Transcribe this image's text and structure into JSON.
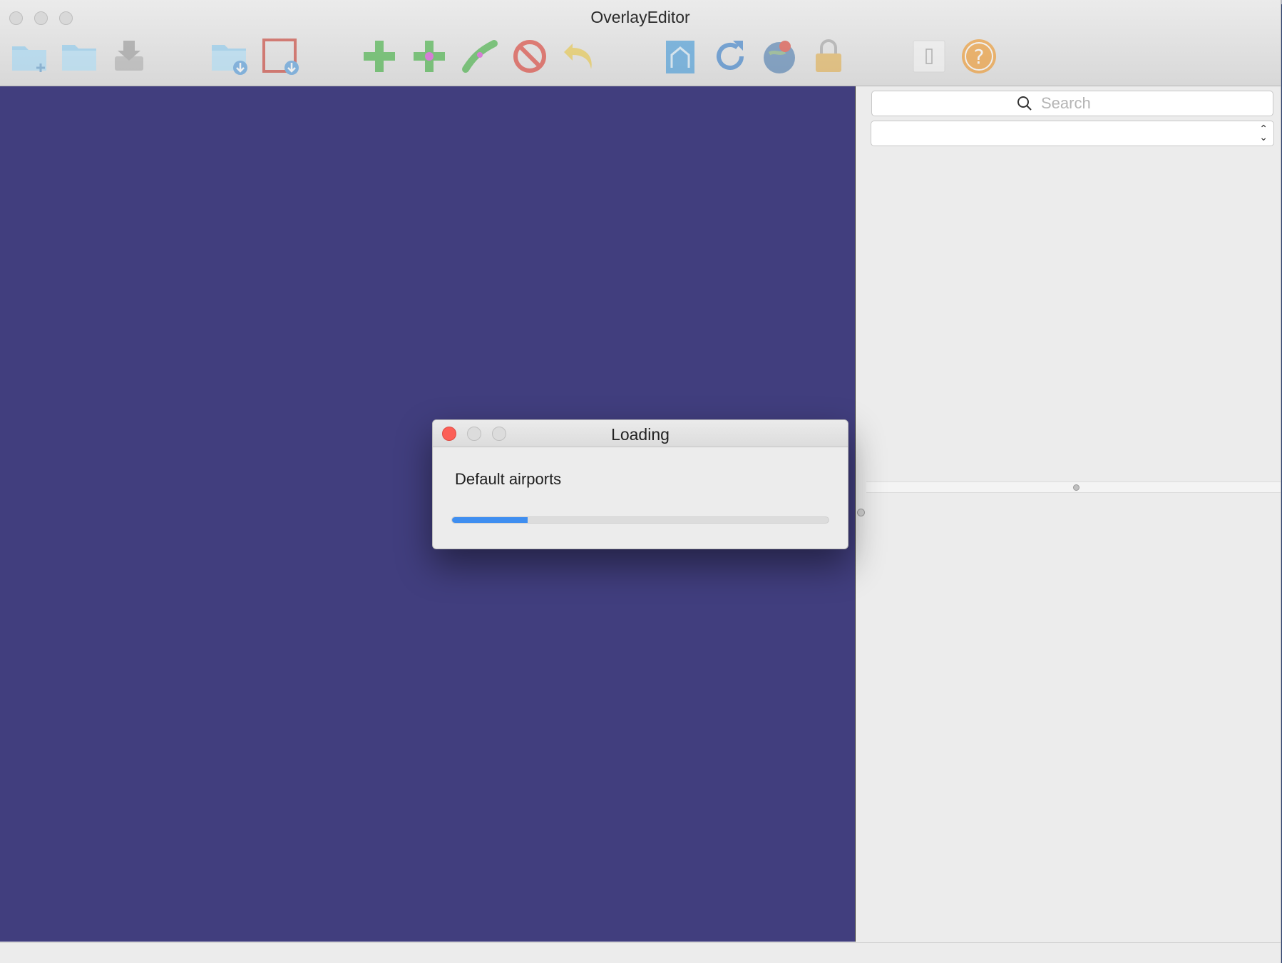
{
  "window": {
    "title": "OverlayEditor"
  },
  "toolbar": {
    "buttons": [
      {
        "name": "new-scenery-icon"
      },
      {
        "name": "open-scenery-icon"
      },
      {
        "name": "save-icon"
      },
      {
        "name": "import-icon"
      },
      {
        "name": "export-icon"
      },
      {
        "name": "add-object-icon"
      },
      {
        "name": "add-node-icon"
      },
      {
        "name": "add-line-icon"
      },
      {
        "name": "delete-icon"
      },
      {
        "name": "undo-icon"
      },
      {
        "name": "preferences-icon"
      },
      {
        "name": "refresh-icon"
      },
      {
        "name": "goto-location-icon"
      },
      {
        "name": "lock-icon"
      },
      {
        "name": "toggle-panel-icon"
      },
      {
        "name": "help-icon"
      }
    ]
  },
  "sidebar": {
    "search": {
      "placeholder": "Search",
      "value": ""
    },
    "category_select": {
      "value": ""
    }
  },
  "dialog": {
    "title": "Loading",
    "message": "Default airports",
    "progress": 0.2
  },
  "colors": {
    "map_background": "#413e7e",
    "progress_fill": "#3f8ef0",
    "close_button": "#fc5f57"
  }
}
